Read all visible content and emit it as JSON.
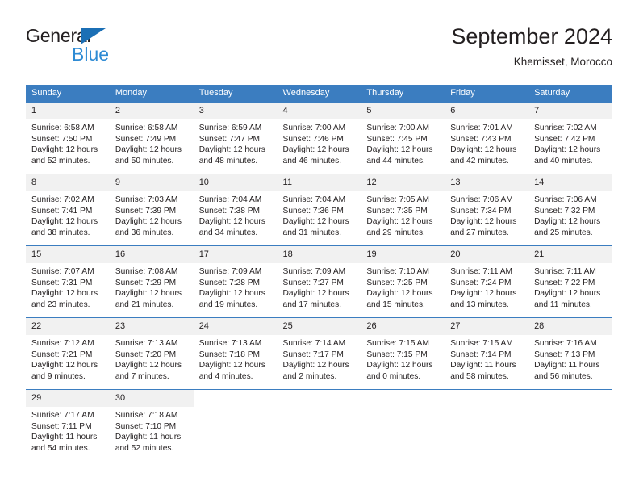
{
  "brand": {
    "name_part1": "General",
    "name_part2": "Blue",
    "triangle_color": "#1b6fb5",
    "blue_color": "#2e8bd4"
  },
  "header": {
    "title": "September 2024",
    "subtitle": "Khemisset, Morocco"
  },
  "theme": {
    "header_bg": "#3b7dc0",
    "daynum_bg": "#f1f1f1",
    "text_color": "#231f20"
  },
  "weekdays": [
    "Sunday",
    "Monday",
    "Tuesday",
    "Wednesday",
    "Thursday",
    "Friday",
    "Saturday"
  ],
  "weeks": [
    [
      {
        "day": "1",
        "sunrise": "Sunrise: 6:58 AM",
        "sunset": "Sunset: 7:50 PM",
        "daylight1": "Daylight: 12 hours",
        "daylight2": "and 52 minutes."
      },
      {
        "day": "2",
        "sunrise": "Sunrise: 6:58 AM",
        "sunset": "Sunset: 7:49 PM",
        "daylight1": "Daylight: 12 hours",
        "daylight2": "and 50 minutes."
      },
      {
        "day": "3",
        "sunrise": "Sunrise: 6:59 AM",
        "sunset": "Sunset: 7:47 PM",
        "daylight1": "Daylight: 12 hours",
        "daylight2": "and 48 minutes."
      },
      {
        "day": "4",
        "sunrise": "Sunrise: 7:00 AM",
        "sunset": "Sunset: 7:46 PM",
        "daylight1": "Daylight: 12 hours",
        "daylight2": "and 46 minutes."
      },
      {
        "day": "5",
        "sunrise": "Sunrise: 7:00 AM",
        "sunset": "Sunset: 7:45 PM",
        "daylight1": "Daylight: 12 hours",
        "daylight2": "and 44 minutes."
      },
      {
        "day": "6",
        "sunrise": "Sunrise: 7:01 AM",
        "sunset": "Sunset: 7:43 PM",
        "daylight1": "Daylight: 12 hours",
        "daylight2": "and 42 minutes."
      },
      {
        "day": "7",
        "sunrise": "Sunrise: 7:02 AM",
        "sunset": "Sunset: 7:42 PM",
        "daylight1": "Daylight: 12 hours",
        "daylight2": "and 40 minutes."
      }
    ],
    [
      {
        "day": "8",
        "sunrise": "Sunrise: 7:02 AM",
        "sunset": "Sunset: 7:41 PM",
        "daylight1": "Daylight: 12 hours",
        "daylight2": "and 38 minutes."
      },
      {
        "day": "9",
        "sunrise": "Sunrise: 7:03 AM",
        "sunset": "Sunset: 7:39 PM",
        "daylight1": "Daylight: 12 hours",
        "daylight2": "and 36 minutes."
      },
      {
        "day": "10",
        "sunrise": "Sunrise: 7:04 AM",
        "sunset": "Sunset: 7:38 PM",
        "daylight1": "Daylight: 12 hours",
        "daylight2": "and 34 minutes."
      },
      {
        "day": "11",
        "sunrise": "Sunrise: 7:04 AM",
        "sunset": "Sunset: 7:36 PM",
        "daylight1": "Daylight: 12 hours",
        "daylight2": "and 31 minutes."
      },
      {
        "day": "12",
        "sunrise": "Sunrise: 7:05 AM",
        "sunset": "Sunset: 7:35 PM",
        "daylight1": "Daylight: 12 hours",
        "daylight2": "and 29 minutes."
      },
      {
        "day": "13",
        "sunrise": "Sunrise: 7:06 AM",
        "sunset": "Sunset: 7:34 PM",
        "daylight1": "Daylight: 12 hours",
        "daylight2": "and 27 minutes."
      },
      {
        "day": "14",
        "sunrise": "Sunrise: 7:06 AM",
        "sunset": "Sunset: 7:32 PM",
        "daylight1": "Daylight: 12 hours",
        "daylight2": "and 25 minutes."
      }
    ],
    [
      {
        "day": "15",
        "sunrise": "Sunrise: 7:07 AM",
        "sunset": "Sunset: 7:31 PM",
        "daylight1": "Daylight: 12 hours",
        "daylight2": "and 23 minutes."
      },
      {
        "day": "16",
        "sunrise": "Sunrise: 7:08 AM",
        "sunset": "Sunset: 7:29 PM",
        "daylight1": "Daylight: 12 hours",
        "daylight2": "and 21 minutes."
      },
      {
        "day": "17",
        "sunrise": "Sunrise: 7:09 AM",
        "sunset": "Sunset: 7:28 PM",
        "daylight1": "Daylight: 12 hours",
        "daylight2": "and 19 minutes."
      },
      {
        "day": "18",
        "sunrise": "Sunrise: 7:09 AM",
        "sunset": "Sunset: 7:27 PM",
        "daylight1": "Daylight: 12 hours",
        "daylight2": "and 17 minutes."
      },
      {
        "day": "19",
        "sunrise": "Sunrise: 7:10 AM",
        "sunset": "Sunset: 7:25 PM",
        "daylight1": "Daylight: 12 hours",
        "daylight2": "and 15 minutes."
      },
      {
        "day": "20",
        "sunrise": "Sunrise: 7:11 AM",
        "sunset": "Sunset: 7:24 PM",
        "daylight1": "Daylight: 12 hours",
        "daylight2": "and 13 minutes."
      },
      {
        "day": "21",
        "sunrise": "Sunrise: 7:11 AM",
        "sunset": "Sunset: 7:22 PM",
        "daylight1": "Daylight: 12 hours",
        "daylight2": "and 11 minutes."
      }
    ],
    [
      {
        "day": "22",
        "sunrise": "Sunrise: 7:12 AM",
        "sunset": "Sunset: 7:21 PM",
        "daylight1": "Daylight: 12 hours",
        "daylight2": "and 9 minutes."
      },
      {
        "day": "23",
        "sunrise": "Sunrise: 7:13 AM",
        "sunset": "Sunset: 7:20 PM",
        "daylight1": "Daylight: 12 hours",
        "daylight2": "and 7 minutes."
      },
      {
        "day": "24",
        "sunrise": "Sunrise: 7:13 AM",
        "sunset": "Sunset: 7:18 PM",
        "daylight1": "Daylight: 12 hours",
        "daylight2": "and 4 minutes."
      },
      {
        "day": "25",
        "sunrise": "Sunrise: 7:14 AM",
        "sunset": "Sunset: 7:17 PM",
        "daylight1": "Daylight: 12 hours",
        "daylight2": "and 2 minutes."
      },
      {
        "day": "26",
        "sunrise": "Sunrise: 7:15 AM",
        "sunset": "Sunset: 7:15 PM",
        "daylight1": "Daylight: 12 hours",
        "daylight2": "and 0 minutes."
      },
      {
        "day": "27",
        "sunrise": "Sunrise: 7:15 AM",
        "sunset": "Sunset: 7:14 PM",
        "daylight1": "Daylight: 11 hours",
        "daylight2": "and 58 minutes."
      },
      {
        "day": "28",
        "sunrise": "Sunrise: 7:16 AM",
        "sunset": "Sunset: 7:13 PM",
        "daylight1": "Daylight: 11 hours",
        "daylight2": "and 56 minutes."
      }
    ],
    [
      {
        "day": "29",
        "sunrise": "Sunrise: 7:17 AM",
        "sunset": "Sunset: 7:11 PM",
        "daylight1": "Daylight: 11 hours",
        "daylight2": "and 54 minutes."
      },
      {
        "day": "30",
        "sunrise": "Sunrise: 7:18 AM",
        "sunset": "Sunset: 7:10 PM",
        "daylight1": "Daylight: 11 hours",
        "daylight2": "and 52 minutes."
      },
      {
        "day": "",
        "sunrise": "",
        "sunset": "",
        "daylight1": "",
        "daylight2": ""
      },
      {
        "day": "",
        "sunrise": "",
        "sunset": "",
        "daylight1": "",
        "daylight2": ""
      },
      {
        "day": "",
        "sunrise": "",
        "sunset": "",
        "daylight1": "",
        "daylight2": ""
      },
      {
        "day": "",
        "sunrise": "",
        "sunset": "",
        "daylight1": "",
        "daylight2": ""
      },
      {
        "day": "",
        "sunrise": "",
        "sunset": "",
        "daylight1": "",
        "daylight2": ""
      }
    ]
  ]
}
